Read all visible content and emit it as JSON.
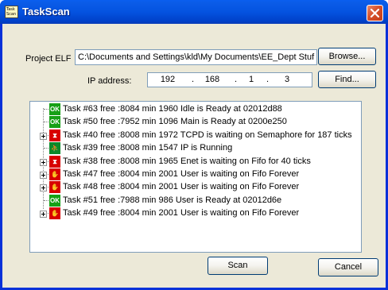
{
  "window": {
    "title": "TaskScan",
    "icon_text_line1": "Task",
    "icon_text_line2": "Scan"
  },
  "project_elf": {
    "label": "Project ELF",
    "value": "C:\\Documents and Settings\\kld\\My Documents\\EE_Dept Stuf",
    "browse_label": "Browse..."
  },
  "ip": {
    "label": "IP address:",
    "octets": [
      "192",
      "168",
      "1",
      "3"
    ],
    "find_label": "Find..."
  },
  "tasks": [
    {
      "icon": "ok-icon",
      "icon_text": "OK",
      "expandable": false,
      "text": "Task #63 free :8084 min 1960 Idle is Ready at 02012d88"
    },
    {
      "icon": "ok-icon",
      "icon_text": "OK",
      "expandable": false,
      "text": "Task #50 free :7952 min 1096 Main is Ready at 0200e250"
    },
    {
      "icon": "hourglass-icon",
      "icon_text": "⧗",
      "expandable": true,
      "text": "Task #40 free :8008 min 1972 TCPD is waiting on Semaphore for 187 ticks"
    },
    {
      "icon": "running-icon",
      "icon_text": "⛹",
      "expandable": false,
      "text": "Task #39 free :8008 min 1547 IP is Running"
    },
    {
      "icon": "hourglass-icon",
      "icon_text": "⧗",
      "expandable": true,
      "text": "Task #38 free :8008 min 1965 Enet is waiting on Fifo for 40 ticks"
    },
    {
      "icon": "hand-icon",
      "icon_text": "✋",
      "expandable": true,
      "text": "Task #47 free :8004 min 2001 User is waiting on Fifo Forever"
    },
    {
      "icon": "hand-icon",
      "icon_text": "✋",
      "expandable": true,
      "text": "Task #48 free :8004 min 2001 User is waiting on Fifo Forever"
    },
    {
      "icon": "ok-icon",
      "icon_text": "OK",
      "expandable": false,
      "text": "Task #51 free :7988 min 986 User is Ready at 02012d6e"
    },
    {
      "icon": "hand-icon",
      "icon_text": "✋",
      "expandable": true,
      "text": "Task #49 free :8004 min 2001 User is waiting on Fifo Forever"
    }
  ],
  "buttons": {
    "scan": "Scan",
    "cancel": "Cancel"
  },
  "colors": {
    "titlebar": "#0453e0",
    "close_button": "#d6502b",
    "dialog_bg": "#ece9d8",
    "ok_icon": "#16a016",
    "wait_icon": "#d80000"
  }
}
